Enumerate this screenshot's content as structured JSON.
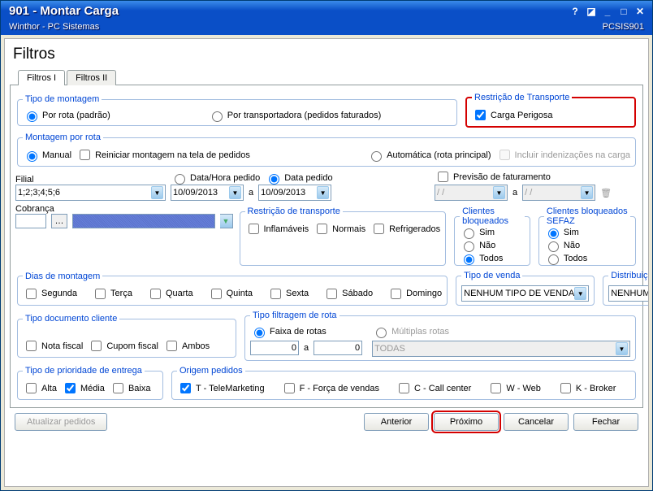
{
  "window": {
    "code_title": "901 - Montar Carga",
    "subtitle_left": "Winthor - PC Sistemas",
    "subtitle_right": "PCSIS901"
  },
  "page_title": "Filtros",
  "tabs": [
    "Filtros I",
    "Filtros II"
  ],
  "tipo_montagem": {
    "legend": "Tipo de montagem",
    "opt1": "Por rota (padrão)",
    "opt2": "Por transportadora (pedidos faturados)"
  },
  "restricao_transp_box": {
    "legend": "Restrição de Transporte",
    "check": "Carga Perigosa"
  },
  "montagem_rota": {
    "legend": "Montagem por rota",
    "opt1": "Manual",
    "chk1": "Reiniciar montagem na tela de pedidos",
    "opt2": "Automática (rota principal)",
    "chk2": "Incluir indenizações na carga"
  },
  "filial": {
    "label": "Filial",
    "value": "1;2;3;4;5;6"
  },
  "data_opts": {
    "opt1": "Data/Hora pedido",
    "opt2": "Data pedido",
    "date1": "10/09/2013",
    "sep": "a",
    "date2": "10/09/2013"
  },
  "previsao": {
    "chk": "Previsão de faturamento",
    "v1": "/   /",
    "sep": "a",
    "v2": "/   /"
  },
  "cobranca_label": "Cobrança",
  "restricao_transporte": {
    "legend": "Restrição de transporte",
    "c1": "Inflamáveis",
    "c2": "Normais",
    "c3": "Refrigerados"
  },
  "cli_bloq": {
    "legend": "Clientes bloqueados",
    "o1": "Sim",
    "o2": "Não",
    "o3": "Todos"
  },
  "cli_bloq_sefaz": {
    "legend": "Clientes bloqueados SEFAZ",
    "o1": "Sim",
    "o2": "Não",
    "o3": "Todos"
  },
  "dias": {
    "legend": "Dias de montagem",
    "d": [
      "Segunda",
      "Terça",
      "Quarta",
      "Quinta",
      "Sexta",
      "Sábado",
      "Domingo"
    ]
  },
  "tipo_venda": {
    "legend": "Tipo de venda",
    "value": "NENHUM TIPO DE VENDA"
  },
  "distribuicao": {
    "legend": "Distribuição",
    "value": "NENHUMA"
  },
  "tipo_doc": {
    "legend": "Tipo documento cliente",
    "c1": "Nota fiscal",
    "c2": "Cupom fiscal",
    "c3": "Ambos"
  },
  "filtragem": {
    "legend": "Tipo filtragem de rota",
    "opt1": "Faixa de rotas",
    "from": "0",
    "sep": "a",
    "to": "0",
    "opt2": "Múltiplas rotas",
    "value2": "TODAS"
  },
  "prioridade": {
    "legend": "Tipo de prioridade de  entrega",
    "c1": "Alta",
    "c2": "Média",
    "c3": "Baixa"
  },
  "origem": {
    "legend": "Origem pedidos",
    "c": [
      "T - TeleMarketing",
      "F - Força de vendas",
      "C - Call center",
      "W - Web",
      "K - Broker"
    ]
  },
  "buttons": {
    "upd": "Atualizar pedidos",
    "prev": "Anterior",
    "next": "Próximo",
    "cancel": "Cancelar",
    "close": "Fechar"
  }
}
